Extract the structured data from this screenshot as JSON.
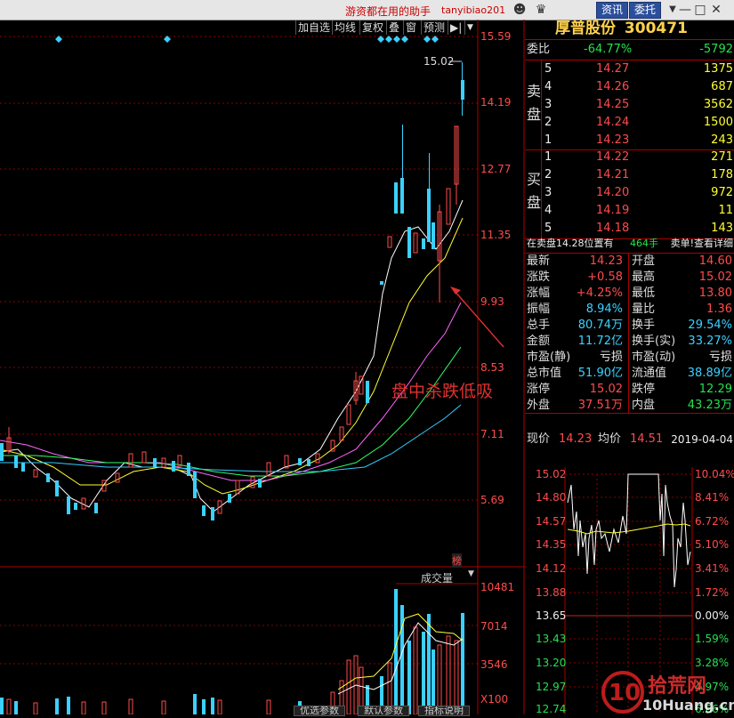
{
  "topbar": {
    "title": "游资都在用的助手",
    "user": "tanyibiao201",
    "btn_news": "资讯",
    "btn_order": "委托"
  },
  "toolbar": {
    "items": [
      "加自选",
      "均线",
      "复权",
      "叠",
      "窗",
      "预测"
    ],
    "nav_glyph": "▶|"
  },
  "price_axis": [
    "15.59",
    "14.19",
    "12.77",
    "11.35",
    "9.93",
    "8.53",
    "7.11",
    "5.69"
  ],
  "max_label": "15.02",
  "badge": "榜",
  "annotation": "盘中杀跌低吸",
  "volume": {
    "header": "成交量",
    "axis": [
      "10481",
      "7014",
      "3546"
    ],
    "unit": "X100"
  },
  "bottom_tabs": [
    "优选参数",
    "默认参数",
    "指标说明"
  ],
  "stock": {
    "name": "厚普股份",
    "code": "300471"
  },
  "weibi": {
    "label": "委比",
    "ratio": "-64.77%",
    "diff": "-5792"
  },
  "sell_label": [
    "卖",
    "盘"
  ],
  "buy_label": [
    "买",
    "盘"
  ],
  "sell": [
    {
      "lvl": "5",
      "price": "14.27",
      "vol": "1375"
    },
    {
      "lvl": "4",
      "price": "14.26",
      "vol": "687"
    },
    {
      "lvl": "3",
      "price": "14.25",
      "vol": "3562"
    },
    {
      "lvl": "2",
      "price": "14.24",
      "vol": "1500"
    },
    {
      "lvl": "1",
      "price": "14.23",
      "vol": "243"
    }
  ],
  "buy": [
    {
      "lvl": "1",
      "price": "14.22",
      "vol": "271"
    },
    {
      "lvl": "2",
      "price": "14.21",
      "vol": "178"
    },
    {
      "lvl": "3",
      "price": "14.20",
      "vol": "972"
    },
    {
      "lvl": "4",
      "price": "14.19",
      "vol": "11"
    },
    {
      "lvl": "5",
      "price": "14.18",
      "vol": "143"
    }
  ],
  "notice": {
    "left": "在卖盘14.28位置有",
    "mid": "464手",
    "right": "卖单!查看详细"
  },
  "stats": [
    {
      "l1": "最新",
      "v1": "14.23",
      "c1": "red",
      "l2": "开盘",
      "v2": "14.60",
      "c2": "red"
    },
    {
      "l1": "涨跌",
      "v1": "+0.58",
      "c1": "red",
      "l2": "最高",
      "v2": "15.02",
      "c2": "red"
    },
    {
      "l1": "涨幅",
      "v1": "+4.25%",
      "c1": "red",
      "l2": "最低",
      "v2": "13.80",
      "c2": "red"
    },
    {
      "l1": "振幅",
      "v1": "8.94%",
      "c1": "cyan",
      "l2": "量比",
      "v2": "1.36",
      "c2": "red"
    },
    {
      "l1": "总手",
      "v1": "80.74万",
      "c1": "cyan",
      "l2": "换手",
      "v2": "29.54%",
      "c2": "cyan"
    },
    {
      "l1": "金额",
      "v1": "11.72亿",
      "c1": "cyan",
      "l2": "换手(实)",
      "v2": "33.27%",
      "c2": "cyan"
    },
    {
      "l1": "市盈(静)",
      "v1": "亏损",
      "c1": "wht",
      "l2": "市盈(动)",
      "v2": "亏损",
      "c2": "wht"
    },
    {
      "l1": "总市值",
      "v1": "51.90亿",
      "c1": "cyan",
      "l2": "流通值",
      "v2": "38.89亿",
      "c2": "cyan"
    },
    {
      "l1": "涨停",
      "v1": "15.02",
      "c1": "red",
      "l2": "跌停",
      "v2": "12.29",
      "c2": "grn"
    },
    {
      "l1": "外盘",
      "v1": "37.51万",
      "c1": "red",
      "l2": "内盘",
      "v2": "43.23万",
      "c2": "grn"
    }
  ],
  "mini": {
    "label_price": "现价",
    "price": "14.23",
    "label_avg": "均价",
    "avg": "14.51",
    "date": "2019-04-04",
    "left_axis": [
      "15.02",
      "14.80",
      "14.57",
      "14.35",
      "14.12",
      "13.88",
      "13.65",
      "13.43",
      "13.20",
      "12.97",
      "12.74"
    ],
    "right_axis": [
      "10.04%",
      "8.41%",
      "6.72%",
      "5.10%",
      "3.41%",
      "1.72%",
      "0.00%",
      "1.59%",
      "3.28%",
      "4.97%",
      "6.66%"
    ]
  },
  "watermark": {
    "brand": "拾荒网",
    "site": "10Huang.cn"
  },
  "colors": {
    "up": "#ff4b4b",
    "down": "#24e24e",
    "cyan": "#3bd1ff",
    "gold": "#ffd24d",
    "grid": "#a00000"
  }
}
